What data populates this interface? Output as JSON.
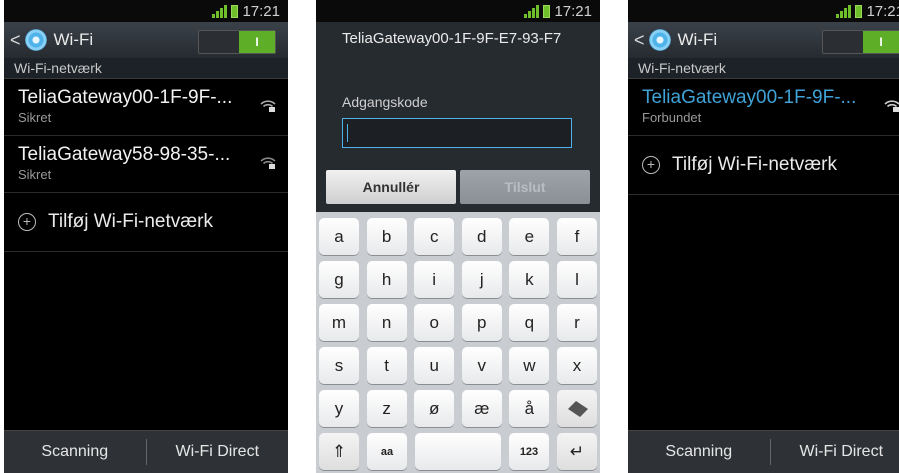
{
  "status": {
    "time": "17:21"
  },
  "screen1": {
    "title": "Wi-Fi",
    "toggle_label": "I",
    "section": "Wi-Fi-netværk",
    "networks": [
      {
        "ssid": "TeliaGateway00-1F-9F-...",
        "status": "Sikret"
      },
      {
        "ssid": "TeliaGateway58-98-35-...",
        "status": "Sikret"
      }
    ],
    "add_network": "Tilføj Wi-Fi-netværk",
    "bottom": {
      "left": "Scanning",
      "right": "Wi-Fi Direct"
    }
  },
  "screen2": {
    "dialog_title": "TeliaGateway00-1F-9F-E7-93-F7",
    "password_label": "Adgangskode",
    "password_value": "",
    "cancel": "Annullér",
    "connect": "Tilslut",
    "keyboard": {
      "row1": [
        "a",
        "b",
        "c",
        "d",
        "e",
        "f"
      ],
      "row2": [
        "g",
        "h",
        "i",
        "j",
        "k",
        "l"
      ],
      "row3": [
        "m",
        "n",
        "o",
        "p",
        "q",
        "r"
      ],
      "row4": [
        "s",
        "t",
        "u",
        "v",
        "w",
        "x"
      ],
      "row5": [
        "y",
        "z",
        "ø",
        "æ",
        "å"
      ],
      "row6": {
        "shift": "⇑",
        "case": "aa",
        "sym": "123",
        "enter": "↵"
      }
    }
  },
  "screen3": {
    "title": "Wi-Fi",
    "toggle_label": "I",
    "section": "Wi-Fi-netværk",
    "network": {
      "ssid": "TeliaGateway00-1F-9F-...",
      "status": "Forbundet"
    },
    "add_network": "Tilføj Wi-Fi-netværk",
    "bottom": {
      "left": "Scanning",
      "right": "Wi-Fi Direct"
    }
  }
}
